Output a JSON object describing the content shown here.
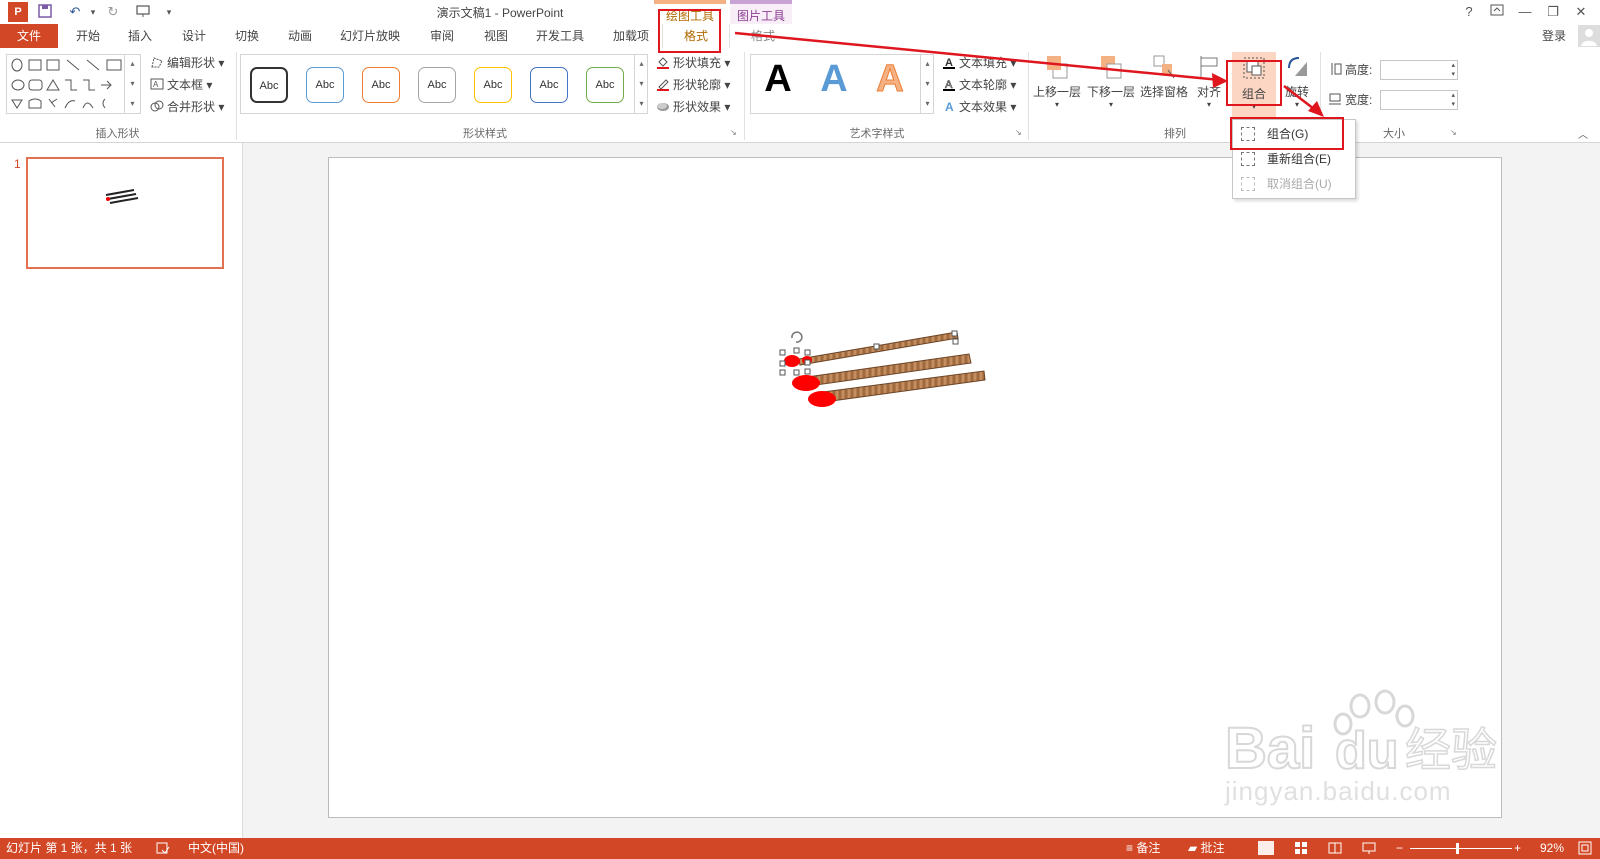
{
  "window": {
    "title": "演示文稿1 - PowerPoint",
    "help": "?",
    "signin": "登录",
    "context_tabs": {
      "drawing_tools": "绘图工具",
      "picture_tools": "图片工具"
    }
  },
  "tabs": [
    "文件",
    "开始",
    "插入",
    "设计",
    "切换",
    "动画",
    "幻灯片放映",
    "审阅",
    "视图",
    "开发工具",
    "加载项",
    "格式",
    "格式"
  ],
  "ribbon": {
    "insert_shapes": {
      "label": "插入形状",
      "edit_shape": "编辑形状",
      "text_box": "文本框",
      "merge_shapes": "合并形状"
    },
    "shape_styles": {
      "label": "形状样式",
      "swatch_text": "Abc",
      "fill": "形状填充",
      "outline": "形状轮廓",
      "effects": "形状效果"
    },
    "wordart": {
      "label": "艺术字样式",
      "letter": "A",
      "text_fill": "文本填充",
      "text_outline": "文本轮廓",
      "text_effects": "文本效果"
    },
    "arrange": {
      "label": "排列",
      "bring_forward": "上移一层",
      "send_backward": "下移一层",
      "selection_pane": "选择窗格",
      "align": "对齐",
      "group": "组合",
      "rotate": "旋转"
    },
    "size": {
      "label": "大小",
      "height_label": "高度:",
      "width_label": "宽度:"
    }
  },
  "group_menu": {
    "items": [
      {
        "label": "组合(G)",
        "enabled": true
      },
      {
        "label": "重新组合(E)",
        "enabled": true
      },
      {
        "label": "取消组合(U)",
        "enabled": false
      }
    ]
  },
  "slides_pane": {
    "slide_number": "1"
  },
  "status": {
    "slide_info": "幻灯片 第 1 张，共 1 张",
    "language": "中文(中国)",
    "notes": "备注",
    "comments": "批注",
    "zoom": "92%"
  },
  "watermark": {
    "text": "jingyan.baidu.com",
    "brand_a": "Bai",
    "brand_b": "du",
    "brand_c": "经验"
  },
  "colors": {
    "accent": "#d24726",
    "highlight": "#e0161e",
    "match_head": "#ff0000",
    "match_stick": "#b37a4c"
  }
}
